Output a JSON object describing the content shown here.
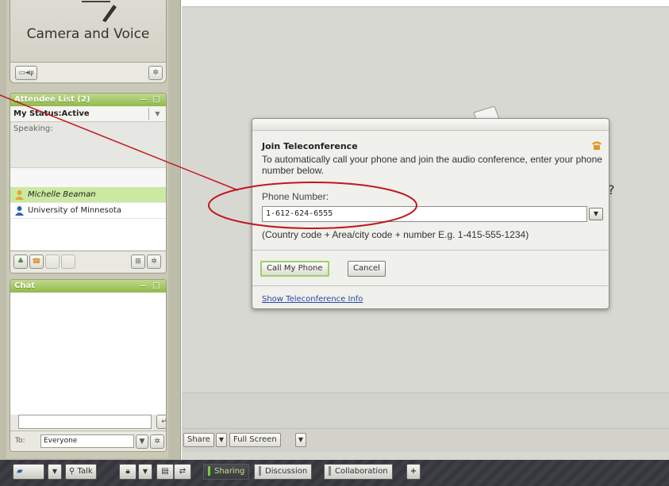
{
  "camera_panel": {
    "title": "Camera and Voice"
  },
  "attendee_panel": {
    "header": "Attendee List (2)",
    "header_controls": "— □",
    "my_status": "My Status:Active",
    "speaking_label": "Speaking:",
    "attendees": [
      {
        "name": "Michelle Beaman",
        "highlighted": true,
        "icon": "presenter-icon"
      },
      {
        "name": "University of Minnesota",
        "highlighted": false,
        "icon": "attendee-icon"
      }
    ]
  },
  "chat_panel": {
    "header": "Chat",
    "header_controls": "— □",
    "to_label": "To:",
    "to_value": "Everyone"
  },
  "main_toolbar": {
    "share_label": "Share",
    "fullscreen_label": "Full Screen"
  },
  "main": {
    "partial_text": "?"
  },
  "bottom_bar": {
    "talk_label": "Talk",
    "tabs": [
      "Sharing",
      "Discussion",
      "Collaboration"
    ],
    "add_label": "+"
  },
  "dialog": {
    "title": "Join Teleconference",
    "description": "To automatically call your phone and join the audio conference, enter your phone number below.",
    "phone_label": "Phone Number:",
    "phone_value": "1-612-624-6555",
    "hint": "(Country code + Area/city code + number E.g. 1-415-555-1234)",
    "call_button": "Call My Phone",
    "cancel_button": "Cancel",
    "info_link": "Show Teleconference Info"
  },
  "colors": {
    "panel_header_green": "#8fba4c",
    "highlight_green": "#cbe9a2",
    "annotation_red": "#c0181e",
    "link_blue": "#2947a6"
  }
}
